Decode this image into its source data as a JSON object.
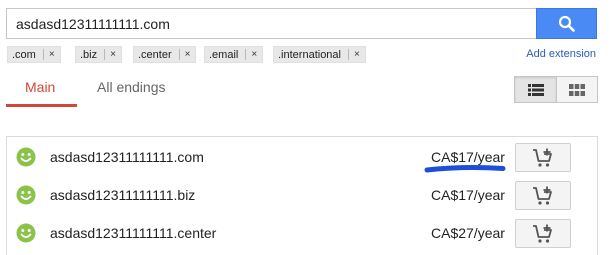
{
  "search": {
    "value": "asdasd12311111111.com",
    "button_icon": "search-icon"
  },
  "extensions": {
    "chips": [
      {
        "label": ".com",
        "remove": "×"
      },
      {
        "label": ".biz",
        "remove": "×"
      },
      {
        "label": ".center",
        "remove": "×"
      },
      {
        "label": ".email",
        "remove": "×"
      },
      {
        "label": ".international",
        "remove": "×"
      }
    ],
    "add_label": "Add extension"
  },
  "tabs": [
    {
      "label": "Main",
      "active": true
    },
    {
      "label": "All endings",
      "active": false
    }
  ],
  "view_toggle": {
    "list_icon": "list-view-icon",
    "grid_icon": "grid-view-icon",
    "active": "list"
  },
  "results": [
    {
      "domain": "asdasd12311111111.com",
      "price": "CA$17/year",
      "status_icon": "smiley-icon",
      "action_icon": "add-to-cart-icon"
    },
    {
      "domain": "asdasd12311111111.biz",
      "price": "CA$17/year",
      "status_icon": "smiley-icon",
      "action_icon": "add-to-cart-icon"
    },
    {
      "domain": "asdasd12311111111.center",
      "price": "CA$27/year",
      "status_icon": "smiley-icon",
      "action_icon": "add-to-cart-icon"
    }
  ],
  "colors": {
    "accent_red": "#d14836",
    "search_blue": "#4a8af4",
    "available_green": "#8bc34a",
    "highlight_blue": "#1f4fd8",
    "link_blue": "#2a5db0"
  }
}
